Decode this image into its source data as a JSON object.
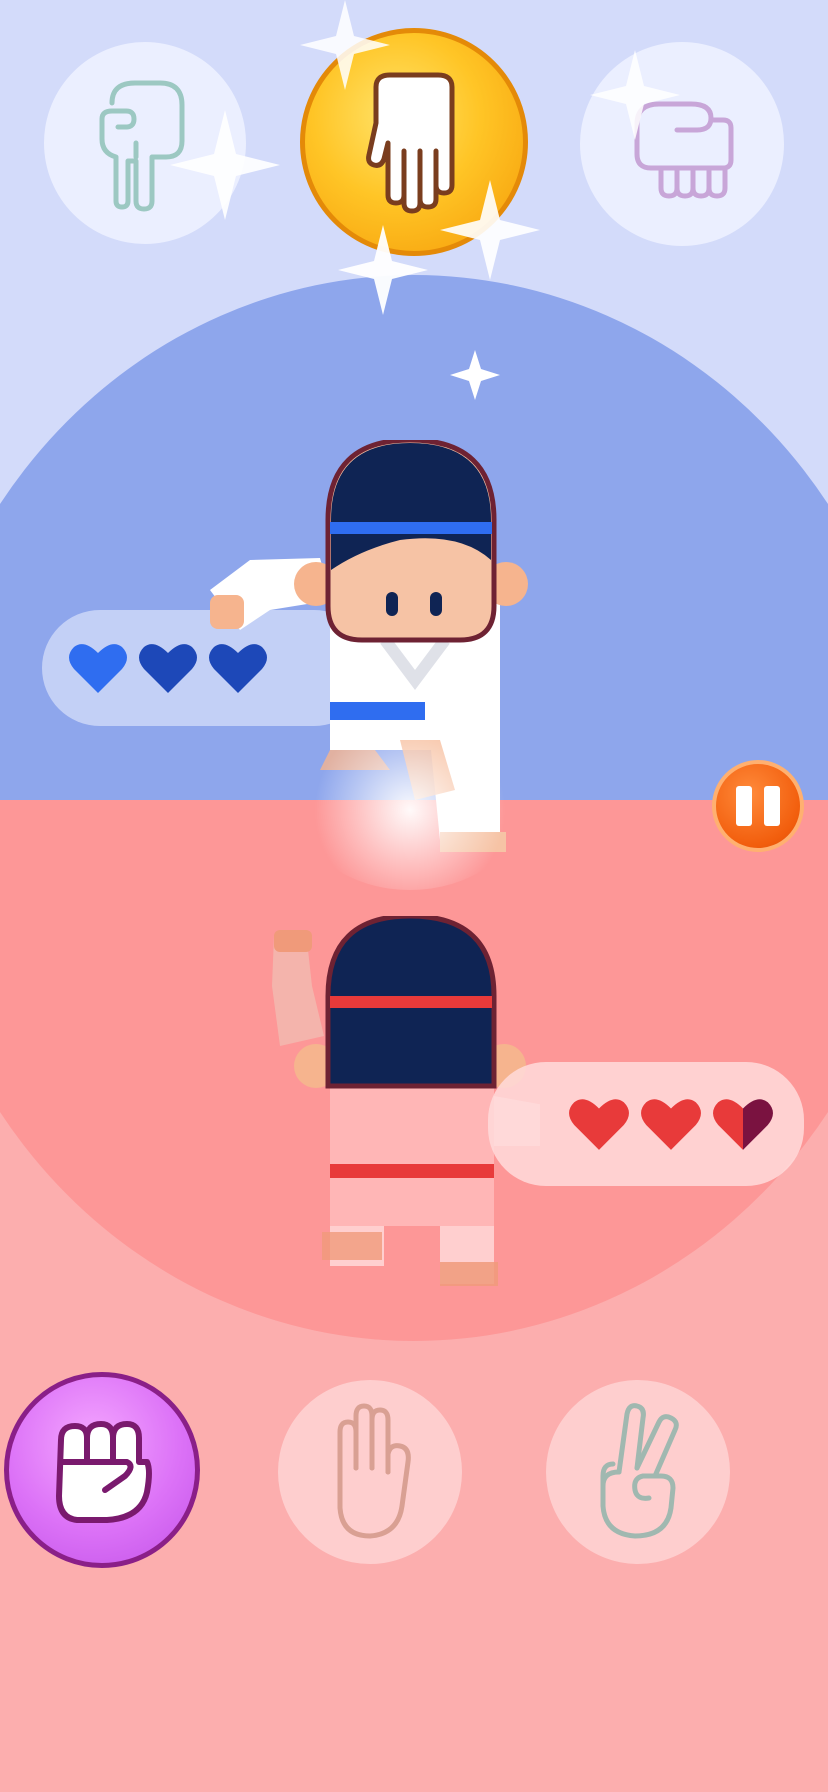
{
  "opponent": {
    "color": "#2f6df0",
    "lives": 3,
    "hearts": [
      "full",
      "full",
      "full"
    ],
    "hand_choices": [
      {
        "name": "point-left-hand-icon",
        "state": "unselected"
      },
      {
        "name": "palm-down-hand-icon",
        "state": "selected-revealed"
      },
      {
        "name": "fist-hand-icon",
        "state": "unselected"
      }
    ]
  },
  "player": {
    "color": "#e83a3a",
    "lives": 2.5,
    "hearts": [
      "full",
      "full",
      "half"
    ],
    "hand_choices": [
      {
        "name": "rock-fist-icon",
        "state": "selected"
      },
      {
        "name": "paper-hand-icon",
        "state": "unselected"
      },
      {
        "name": "scissors-hand-icon",
        "state": "unselected"
      }
    ]
  },
  "colors": {
    "top_background": "#d3dbfa",
    "top_arena": "#8ea6ec",
    "bottom_background": "#fcaeae",
    "bottom_arena": "#fd9797",
    "coin_gold": "#ffc526",
    "selected_purple": "#dc72f7",
    "pause_orange": "#f25e0d"
  },
  "icons": {
    "pause": "pause-icon"
  }
}
